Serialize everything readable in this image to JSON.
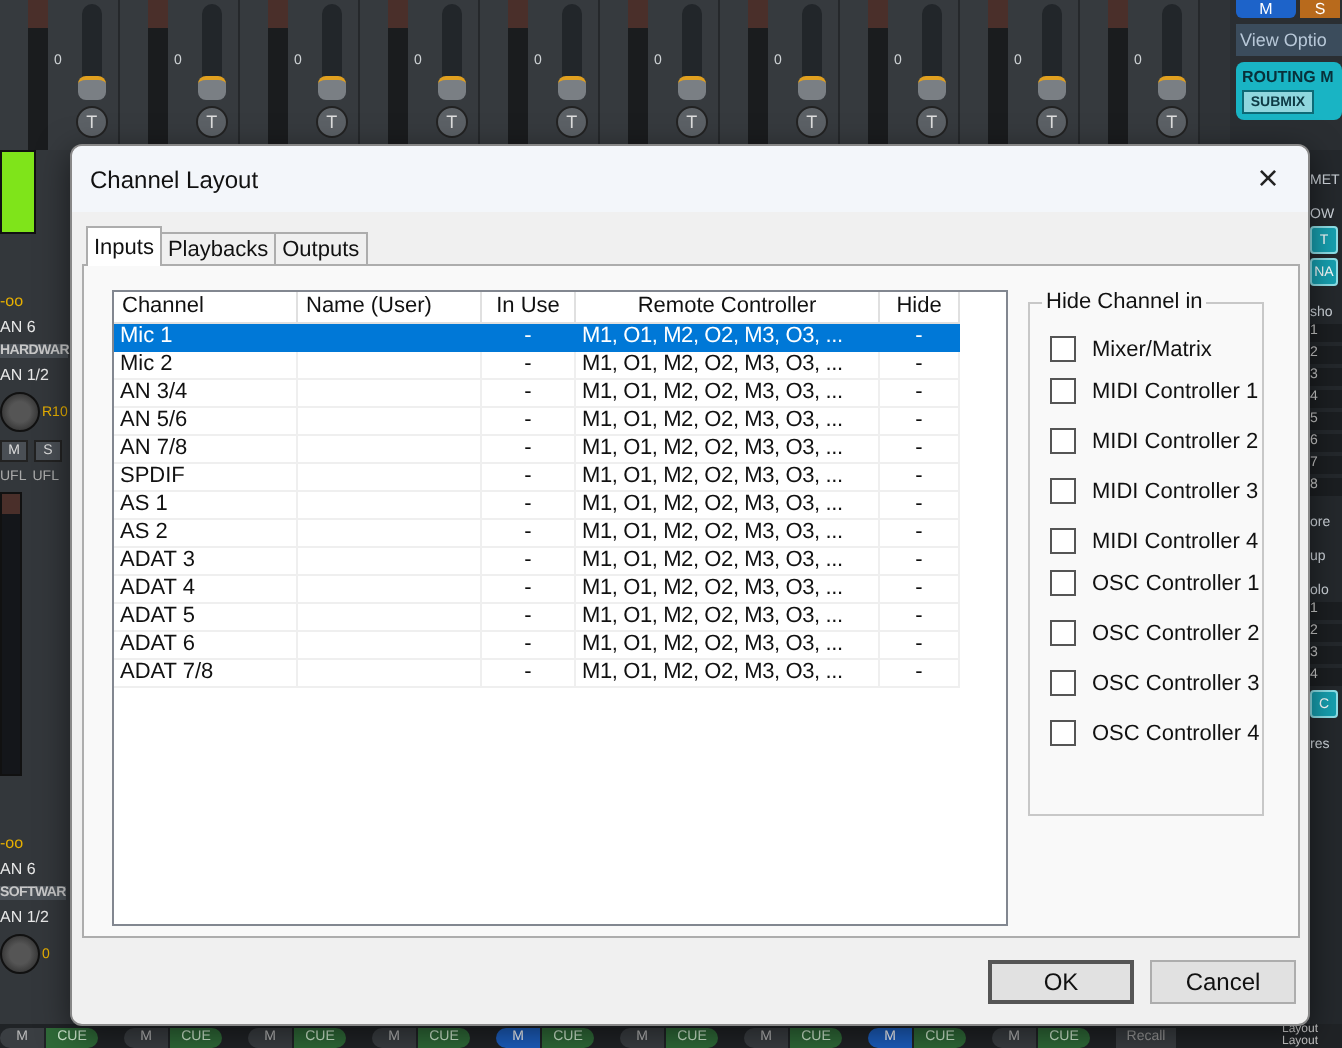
{
  "mixer": {
    "top_strips": [
      {
        "scale": "0",
        "button": "T"
      },
      {
        "scale": "0",
        "button": "T"
      },
      {
        "scale": "0",
        "button": "T"
      },
      {
        "scale": "0",
        "button": "T"
      },
      {
        "scale": "0",
        "button": "T"
      },
      {
        "scale": "0",
        "button": "T"
      },
      {
        "scale": "0",
        "button": "T"
      },
      {
        "scale": "0",
        "button": "T"
      },
      {
        "scale": "0",
        "button": "T"
      },
      {
        "scale": "0",
        "button": "T"
      }
    ],
    "side_panel": {
      "mute": "M",
      "solo": "S",
      "view_options": "View Optio",
      "routing": "ROUTING M",
      "submix": "SUBMIX"
    },
    "left_strip": {
      "hardware": {
        "reading": "-oo",
        "source": "AN 6",
        "section": "HARDWAR",
        "channel": "AN 1/2",
        "pan": "R10",
        "mute": "M",
        "solo": "S",
        "ufl": [
          "UFL",
          "UFL"
        ]
      },
      "software": {
        "reading": "-oo",
        "source": "AN 6",
        "section": "SOFTWAR",
        "channel": "AN 1/2",
        "pan": "0"
      }
    },
    "right_strip": [
      {
        "kind": "heading",
        "text": "MET"
      },
      {
        "kind": "heading",
        "text": "OW"
      },
      {
        "kind": "button",
        "text": "T"
      },
      {
        "kind": "button",
        "text": "NA"
      },
      {
        "kind": "heading",
        "text": "sho"
      },
      {
        "kind": "row",
        "text": "1"
      },
      {
        "kind": "row",
        "text": "2"
      },
      {
        "kind": "row",
        "text": "3"
      },
      {
        "kind": "row",
        "text": "4"
      },
      {
        "kind": "row",
        "text": "5"
      },
      {
        "kind": "row",
        "text": "6"
      },
      {
        "kind": "row",
        "text": "7"
      },
      {
        "kind": "row",
        "text": "8"
      },
      {
        "kind": "heading",
        "text": "ore"
      },
      {
        "kind": "heading",
        "text": "up"
      },
      {
        "kind": "heading",
        "text": "olo"
      },
      {
        "kind": "row",
        "text": "1"
      },
      {
        "kind": "row",
        "text": "2"
      },
      {
        "kind": "row",
        "text": "3"
      },
      {
        "kind": "row",
        "text": "4"
      },
      {
        "kind": "button",
        "text": "C"
      },
      {
        "kind": "heading",
        "text": "res"
      }
    ],
    "bottom_strip": {
      "channels": [
        {
          "mute": "M",
          "cue": "CUE",
          "on": false
        },
        {
          "mute": "M",
          "cue": "CUE",
          "on": false
        },
        {
          "mute": "M",
          "cue": "CUE",
          "on": false
        },
        {
          "mute": "M",
          "cue": "CUE",
          "on": false
        },
        {
          "mute": "M",
          "cue": "CUE",
          "on": true
        },
        {
          "mute": "M",
          "cue": "CUE",
          "on": false
        },
        {
          "mute": "M",
          "cue": "CUE",
          "on": false
        },
        {
          "mute": "M",
          "cue": "CUE",
          "on": true
        },
        {
          "mute": "M",
          "cue": "CUE",
          "on": false
        }
      ],
      "recall": "Recall",
      "layout": [
        "Layout",
        "Layout"
      ]
    }
  },
  "dialog": {
    "title": "Channel Layout",
    "close": "×",
    "tabs": [
      {
        "label": "Inputs",
        "selected": true
      },
      {
        "label": "Playbacks",
        "selected": false
      },
      {
        "label": "Outputs",
        "selected": false
      }
    ],
    "table": {
      "columns": [
        "Channel",
        "Name (User)",
        "In Use",
        "Remote Controller",
        "Hide"
      ],
      "rows": [
        {
          "channel": "Mic 1",
          "in_use": "-",
          "remote": "M1, O1, M2, O2, M3, O3, ...",
          "hide": "-",
          "selected": true
        },
        {
          "channel": "Mic 2",
          "in_use": "-",
          "remote": "M1, O1, M2, O2, M3, O3, ...",
          "hide": "-",
          "selected": false
        },
        {
          "channel": "AN 3/4",
          "in_use": "-",
          "remote": "M1, O1, M2, O2, M3, O3, ...",
          "hide": "-",
          "selected": false
        },
        {
          "channel": "AN 5/6",
          "in_use": "-",
          "remote": "M1, O1, M2, O2, M3, O3, ...",
          "hide": "-",
          "selected": false
        },
        {
          "channel": "AN 7/8",
          "in_use": "-",
          "remote": "M1, O1, M2, O2, M3, O3, ...",
          "hide": "-",
          "selected": false
        },
        {
          "channel": "SPDIF",
          "in_use": "-",
          "remote": "M1, O1, M2, O2, M3, O3, ...",
          "hide": "-",
          "selected": false
        },
        {
          "channel": "AS 1",
          "in_use": "-",
          "remote": "M1, O1, M2, O2, M3, O3, ...",
          "hide": "-",
          "selected": false
        },
        {
          "channel": "AS 2",
          "in_use": "-",
          "remote": "M1, O1, M2, O2, M3, O3, ...",
          "hide": "-",
          "selected": false
        },
        {
          "channel": "ADAT 3",
          "in_use": "-",
          "remote": "M1, O1, M2, O2, M3, O3, ...",
          "hide": "-",
          "selected": false
        },
        {
          "channel": "ADAT 4",
          "in_use": "-",
          "remote": "M1, O1, M2, O2, M3, O3, ...",
          "hide": "-",
          "selected": false
        },
        {
          "channel": "ADAT 5",
          "in_use": "-",
          "remote": "M1, O1, M2, O2, M3, O3, ...",
          "hide": "-",
          "selected": false
        },
        {
          "channel": "ADAT 6",
          "in_use": "-",
          "remote": "M1, O1, M2, O2, M3, O3, ...",
          "hide": "-",
          "selected": false
        },
        {
          "channel": "ADAT 7/8",
          "in_use": "-",
          "remote": "M1, O1, M2, O2, M3, O3, ...",
          "hide": "-",
          "selected": false
        }
      ]
    },
    "hide_channel_in": {
      "title": "Hide Channel in",
      "groups": [
        [
          {
            "label": "Mixer/Matrix",
            "checked": false
          }
        ],
        [
          {
            "label": "MIDI Controller 1",
            "checked": false
          },
          {
            "label": "MIDI Controller 2",
            "checked": false
          },
          {
            "label": "MIDI Controller 3",
            "checked": false
          },
          {
            "label": "MIDI Controller 4",
            "checked": false
          }
        ],
        [
          {
            "label": "OSC Controller 1",
            "checked": false
          },
          {
            "label": "OSC Controller 2",
            "checked": false
          },
          {
            "label": "OSC Controller 3",
            "checked": false
          },
          {
            "label": "OSC Controller 4",
            "checked": false
          }
        ]
      ]
    },
    "buttons": [
      "OK",
      "Cancel"
    ]
  }
}
